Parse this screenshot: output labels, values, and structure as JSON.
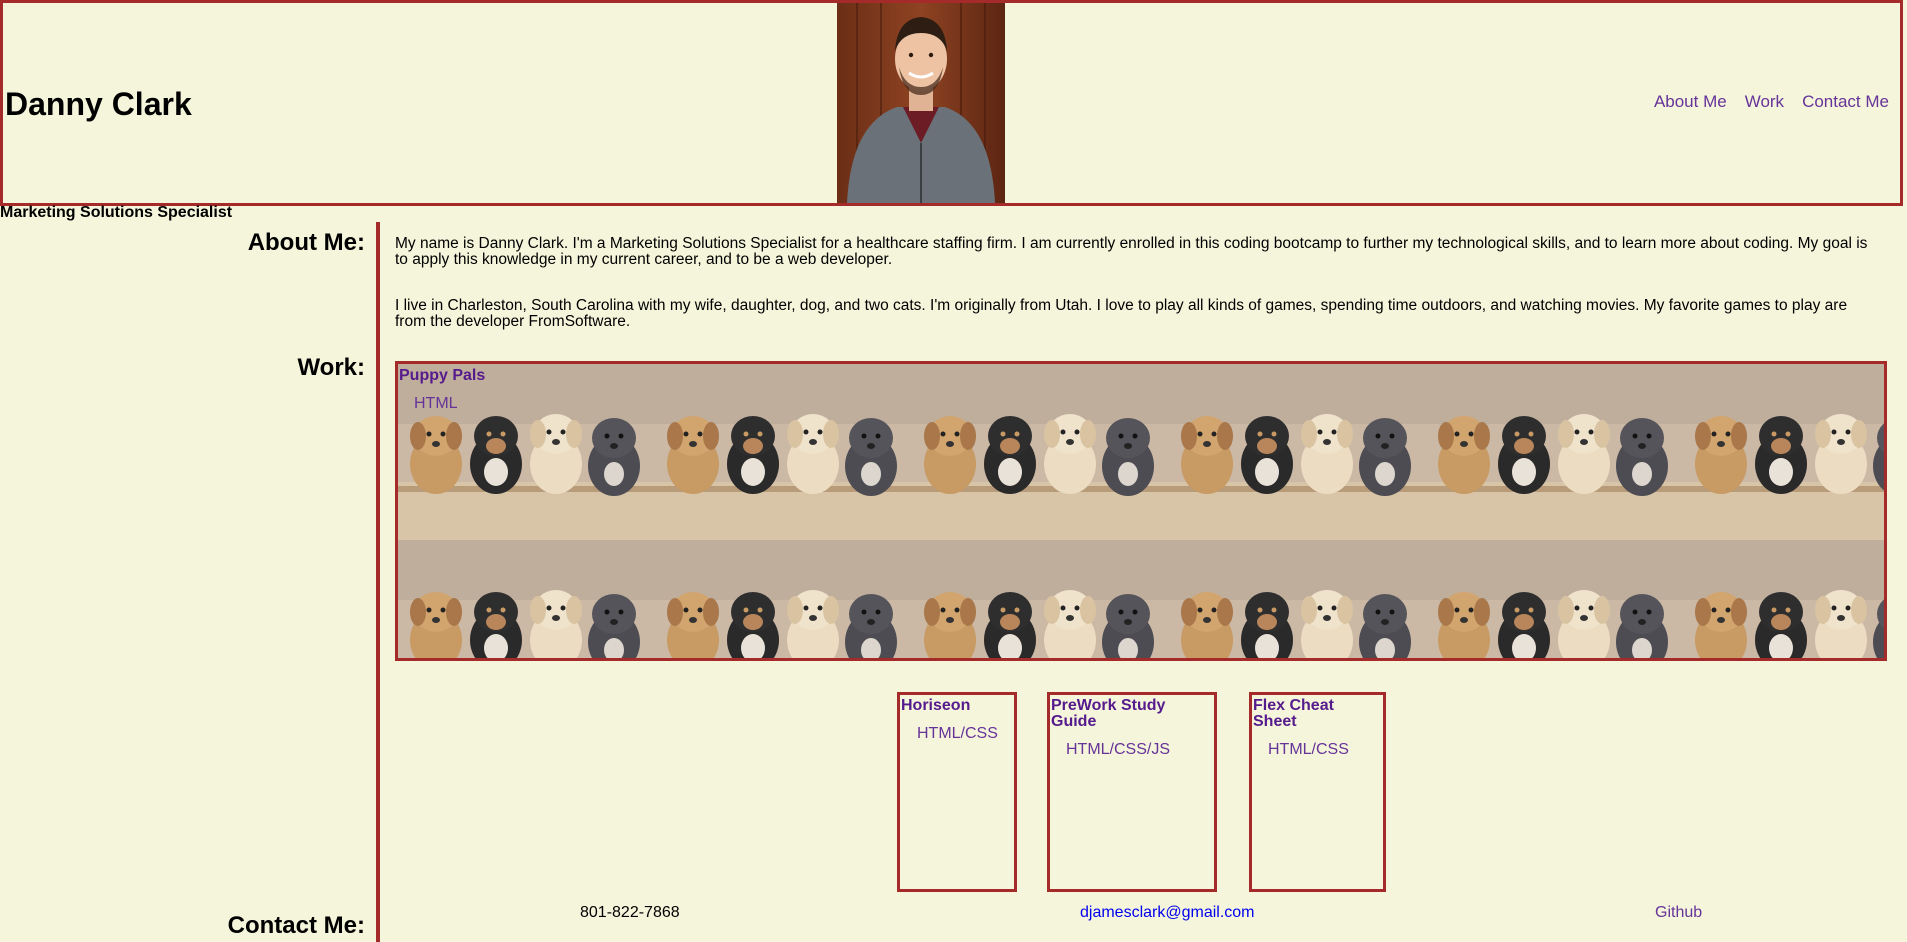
{
  "header": {
    "name": "Danny Clark",
    "nav": [
      {
        "label": "About Me"
      },
      {
        "label": "Work"
      },
      {
        "label": "Contact Me"
      }
    ]
  },
  "tagline": "Marketing Solutions Specialist",
  "about": {
    "label": "About Me:",
    "paragraphs": [
      "My name is Danny Clark. I'm a Marketing Solutions Specialist for a healthcare staffing firm. I am currently enrolled in this coding bootcamp to further my technological skills, and to learn more about coding. My goal is to apply this knowledge in my current career, and to be a web developer.",
      "I live in Charleston, South Carolina with my wife, daughter, dog, and two cats. I'm originally from Utah. I love to play all kinds of games, spending time outdoors, and watching movies. My favorite games to play are from the developer FromSoftware."
    ]
  },
  "work": {
    "label": "Work:",
    "featured": {
      "title": "Puppy Pals",
      "tech": "HTML"
    },
    "projects": [
      {
        "title": "Horiseon",
        "tech": "HTML/CSS"
      },
      {
        "title": "PreWork Study Guide",
        "tech": "HTML/CSS/JS"
      },
      {
        "title": "Flex Cheat Sheet",
        "tech": "HTML/CSS"
      }
    ]
  },
  "contact": {
    "label": "Contact Me:",
    "phone": "801-822-7868",
    "email": "djamesclark@gmail.com",
    "github": "Github"
  },
  "colors": {
    "background": "#f5f5dc",
    "border": "#a52a2a",
    "link": "#663399",
    "email_link": "#0000ee"
  }
}
